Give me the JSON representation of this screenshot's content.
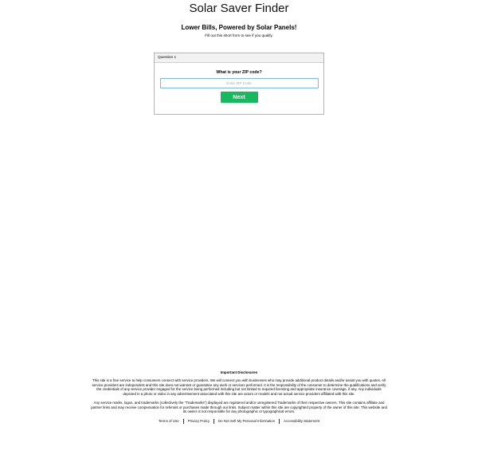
{
  "site": {
    "title": "Solar Saver Finder"
  },
  "hero": {
    "headline": "Lower Bills, Powered by Solar Panels!",
    "subhead": "Fill out this short form to see if you qualify."
  },
  "form": {
    "step_label": "Question 1",
    "question": "What is your ZIP code?",
    "zip_placeholder": "Enter ZIP Code",
    "zip_value": "",
    "next_label": "Next"
  },
  "footer": {
    "disclosures_title": "Important Disclosures",
    "paragraph_1": "This site is a free service to help consumers connect with service providers. We will connect you with businesses who may provide additional product details and/or assist you with quotes. All service providers are independent and this site does not warrant or guarantee any work or services performed. It is the responsibility of the consumer to determine the qualifications and verify the credentials of any service provider engaged for the service being performed including but not limited to required licensing and appropriate insurance coverage, if any.  Any individuals depicted in a photo or video in any advertisement associated with this site are actors or models and not actual service providers affiliated with this site.",
    "paragraph_2": "Any service marks, logos, and trademarks (collectively the \"Trademarks\") displayed are registered and/or unregistered Trademarks of their respective owners.  This site contains affiliate and partner links and may receive compensation for referrals or purchases made through our links. Subject matter within this site are copyrighted property of the owner of this site.  This website and its owner is not responsible for any photographic or typographical errors.",
    "links": {
      "terms": "Terms of Use",
      "privacy": "Privacy Policy",
      "do_not_sell": "Do Not Sell My Personal Information",
      "accessibility": "Accessibility Statement"
    }
  },
  "colors": {
    "next_button": "#17b95f",
    "input_border": "#7fb7ea",
    "card_border": "#b5b5b5"
  }
}
